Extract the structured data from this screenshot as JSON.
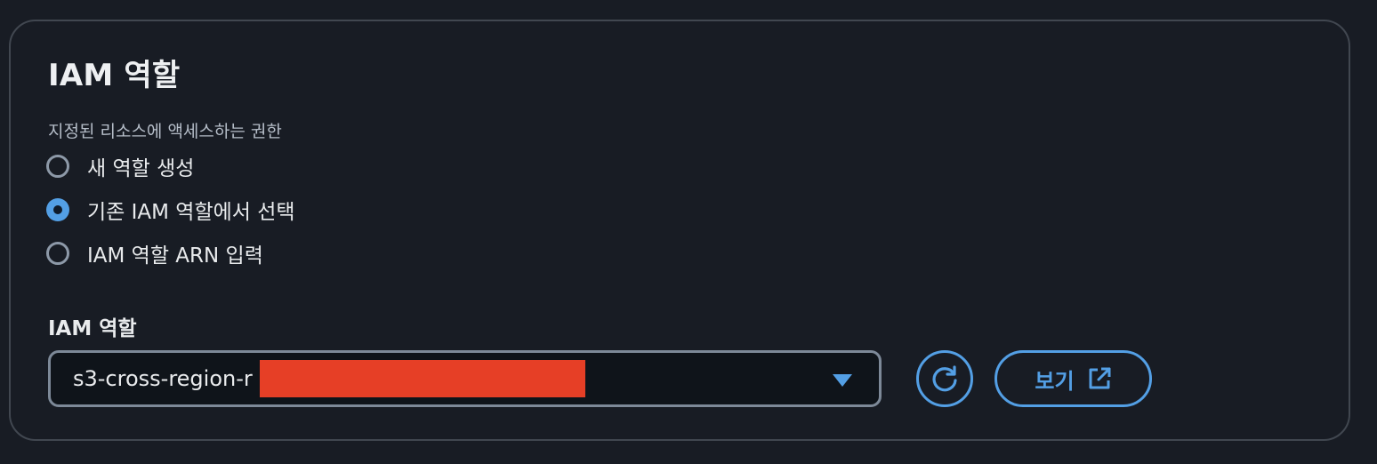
{
  "panel": {
    "title": "IAM 역할",
    "description": "지정된 리소스에 액세스하는 권한"
  },
  "radio_options": [
    {
      "label": "새 역할 생성",
      "selected": false
    },
    {
      "label": "기존 IAM 역할에서 선택",
      "selected": true
    },
    {
      "label": "IAM 역할 ARN 입력",
      "selected": false
    }
  ],
  "role_field": {
    "label": "IAM 역할",
    "selected_value": "s3-cross-region-r",
    "value_redacted": true
  },
  "buttons": {
    "refresh_icon": "refresh-icon",
    "view_label": "보기",
    "view_icon": "external-link-icon"
  },
  "colors": {
    "accent": "#539fe5",
    "background": "#181c24",
    "border": "#414750",
    "redaction": "#e63f26"
  }
}
